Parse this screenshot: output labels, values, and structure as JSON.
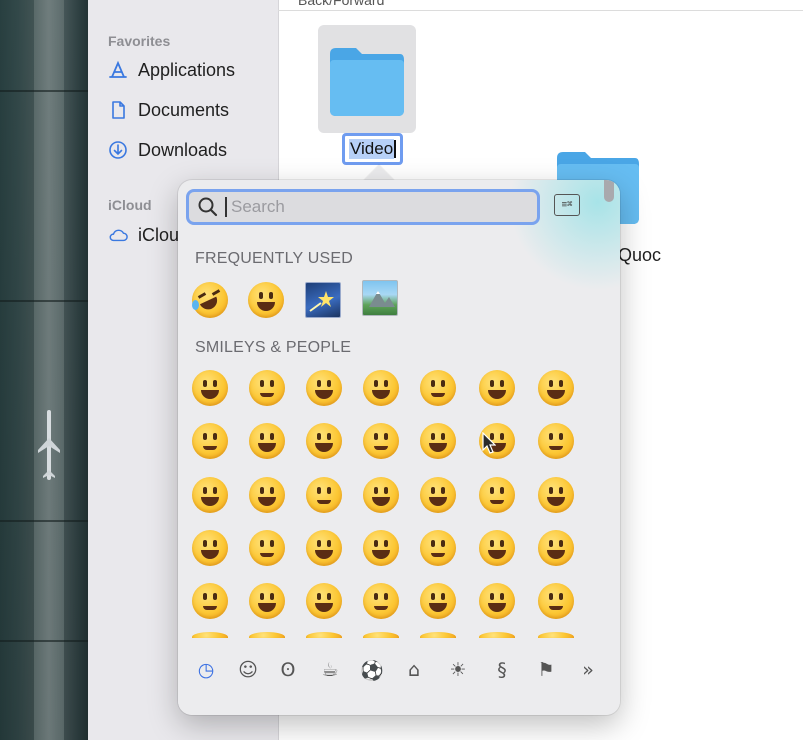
{
  "finder": {
    "toolbar_hint": "Back/Forward",
    "sidebar": {
      "favorites_title": "Favorites",
      "items": [
        {
          "label": "Applications",
          "icon": "applications-icon"
        },
        {
          "label": "Documents",
          "icon": "document-icon"
        },
        {
          "label": "Downloads",
          "icon": "download-icon"
        }
      ],
      "icloud_title": "iCloud",
      "icloud_item": "iClou"
    },
    "files": [
      {
        "name": "Video",
        "icon": "folder-icon",
        "state": "renaming"
      },
      {
        "name": "Quoc",
        "icon": "folder-icon"
      }
    ],
    "colors": {
      "folder": "#5eb6ef",
      "selection": "#6f9cf0"
    }
  },
  "emoji_picker": {
    "search": {
      "placeholder": "Search",
      "value": ""
    },
    "keyboard_button_icon": "character-viewer-icon",
    "sections": [
      {
        "title": "FREQUENTLY USED"
      },
      {
        "title": "SMILEYS & PEOPLE"
      }
    ],
    "categories": [
      {
        "icon": "clock-icon",
        "glyph": "◷",
        "active": true
      },
      {
        "icon": "smiley-icon",
        "glyph": "☺"
      },
      {
        "icon": "bear-icon",
        "glyph": "ʘ"
      },
      {
        "icon": "food-icon",
        "glyph": "☕"
      },
      {
        "icon": "soccer-ball-icon",
        "glyph": "⚽"
      },
      {
        "icon": "building-icon",
        "glyph": "⌂"
      },
      {
        "icon": "lightbulb-icon",
        "glyph": "☀"
      },
      {
        "icon": "symbols-icon",
        "glyph": "§"
      },
      {
        "icon": "flag-icon",
        "glyph": "⚑"
      },
      {
        "icon": "more-icon",
        "glyph": "»"
      }
    ]
  }
}
